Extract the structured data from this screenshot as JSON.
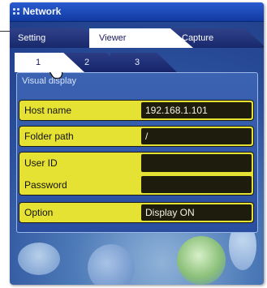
{
  "window": {
    "title": "Network",
    "tabs": [
      {
        "label": "Setting",
        "active": false
      },
      {
        "label": "Viewer",
        "active": true
      },
      {
        "label": "Capture",
        "active": false
      }
    ],
    "subtabs": [
      {
        "label": "1",
        "active": true
      },
      {
        "label": "2",
        "active": false
      },
      {
        "label": "3",
        "active": false
      }
    ]
  },
  "panel": {
    "heading": "Visual display",
    "host_name": {
      "label": "Host name",
      "value": "192.168.1.101"
    },
    "folder_path": {
      "label": "Folder path",
      "value": "/"
    },
    "user_id": {
      "label": "User ID",
      "value": ""
    },
    "password": {
      "label": "Password",
      "value": ""
    },
    "option": {
      "label": "Option",
      "value": "Display ON"
    }
  },
  "colors": {
    "title_bar": "#1f4fc4",
    "field_label_bg": "#e6e233",
    "field_value_bg": "#1e1c0c",
    "panel_bg": "#3458a8"
  },
  "icons": {
    "title": "grid-icon",
    "pointer": "hand-cursor-icon",
    "background": "camera-icon"
  }
}
